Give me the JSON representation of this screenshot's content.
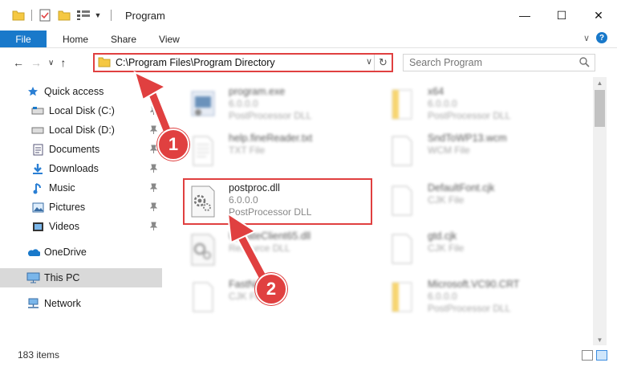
{
  "window": {
    "title": "Program",
    "controls": {
      "minimize": "—",
      "maximize": "☐",
      "close": "✕"
    }
  },
  "ribbon": {
    "file": "File",
    "tabs": [
      "Home",
      "Share",
      "View"
    ],
    "expand": "∨",
    "help": "?"
  },
  "address": {
    "path": "C:\\Program Files\\Program Directory",
    "dropdown": "∨",
    "refresh": "↻",
    "search_placeholder": "Search Program"
  },
  "nav_buttons": {
    "back": "←",
    "forward": "→",
    "recent": "∨",
    "up": "↑"
  },
  "sidebar": {
    "items": [
      {
        "label": "Quick access",
        "icon": "star-icon",
        "pinned": false
      },
      {
        "label": "Local Disk (C:)",
        "icon": "drive-icon",
        "pinned": true
      },
      {
        "label": "Local Disk (D:)",
        "icon": "drive-icon",
        "pinned": true
      },
      {
        "label": "Documents",
        "icon": "documents-icon",
        "pinned": true
      },
      {
        "label": "Downloads",
        "icon": "downloads-icon",
        "pinned": true
      },
      {
        "label": "Music",
        "icon": "music-icon",
        "pinned": true
      },
      {
        "label": "Pictures",
        "icon": "pictures-icon",
        "pinned": true
      },
      {
        "label": "Videos",
        "icon": "videos-icon",
        "pinned": true
      },
      {
        "label": "OneDrive",
        "icon": "onedrive-icon",
        "pinned": false
      },
      {
        "label": "This PC",
        "icon": "pc-icon",
        "pinned": false,
        "selected": true
      },
      {
        "label": "Network",
        "icon": "network-icon",
        "pinned": false
      }
    ]
  },
  "files": [
    {
      "name": "program.exe",
      "line2": "6.0.0.0",
      "line3": "PostProcessor DLL",
      "icon": "exe-icon"
    },
    {
      "name": "x64",
      "line2": "6.0.0.0",
      "line3": "PostProcessor DLL",
      "icon": "folder-file-icon"
    },
    {
      "name": "help.fineReader.txt",
      "line2": "TXT File",
      "line3": "",
      "icon": "text-file-icon"
    },
    {
      "name": "SndToWP13.wcm",
      "line2": "WCM File",
      "line3": "",
      "icon": "blank-file-icon"
    },
    {
      "name": "postproc.dll",
      "line2": "6.0.0.0",
      "line3": "PostProcessor DLL",
      "icon": "dll-gear-icon"
    },
    {
      "name": "DefaultFont.cjk",
      "line2": "CJK File",
      "line3": "",
      "icon": "blank-file-icon"
    },
    {
      "name": "UpdateClient65.dll",
      "line2": "Resource DLL",
      "line3": "",
      "icon": "dll-gear-icon"
    },
    {
      "name": "gtd.cjk",
      "line2": "CJK File",
      "line3": "",
      "icon": "blank-file-icon"
    },
    {
      "name": "FastNot...",
      "line2": "CJK File",
      "line3": "",
      "icon": "blank-file-icon"
    },
    {
      "name": "Microsoft.VC90.CRT",
      "line2": "6.0.0.0",
      "line3": "PostProcessor DLL",
      "icon": "folder-file-icon"
    }
  ],
  "annotations": {
    "step1": "1",
    "step2": "2"
  },
  "status": {
    "count": "183 items"
  },
  "colors": {
    "accent": "#1979ca",
    "highlight": "#e04040",
    "selection": "#d9d9d9"
  }
}
